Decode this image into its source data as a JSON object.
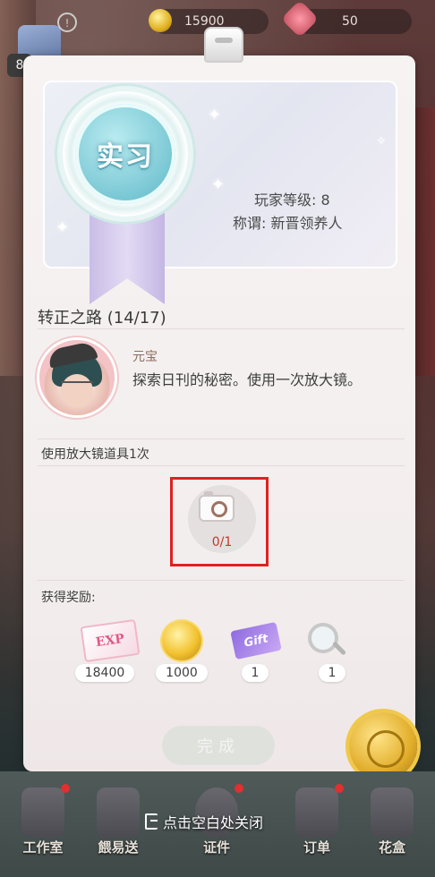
{
  "hud": {
    "gold_amount": "15900",
    "gem_amount": "50",
    "level_badge": "8",
    "hint_symbol": "!"
  },
  "card": {
    "rank_medal_text": "实习",
    "player_level": "玩家等级: 8",
    "player_title": "称谓: 新晋领养人",
    "road_title": "转正之路 (14/17)",
    "npc": {
      "name": "元宝",
      "message": "探索日刊的秘密。使用一次放大镜。"
    },
    "task": {
      "label": "使用放大镜道具1次",
      "progress": "0/1",
      "icon": "camera-icon"
    },
    "rewards_label": "获得奖励:",
    "rewards": [
      {
        "icon": "exp-card-icon",
        "art_text": "EXP",
        "amount": "18400"
      },
      {
        "icon": "gold-coin-icon",
        "amount": "1000"
      },
      {
        "icon": "purple-ticket-icon",
        "art_text": "Gift",
        "amount": "1"
      },
      {
        "icon": "magnifier-icon",
        "amount": "1"
      }
    ],
    "complete_button": "完成"
  },
  "bottom_nav": {
    "close_hint": "点击空白处关闭",
    "items": [
      {
        "label": "工作室",
        "icon": "workshop-icon",
        "badge": true
      },
      {
        "label": "餵易送",
        "icon": "delivery-icon",
        "badge": false
      },
      {
        "label": "证件",
        "icon": "certificate-icon",
        "badge": true
      },
      {
        "label": "订单",
        "icon": "order-icon",
        "badge": true
      },
      {
        "label": "花盒",
        "icon": "flower-box-icon",
        "badge": false
      }
    ]
  },
  "colors": {
    "highlight_box": "#e02020",
    "progress_text": "#c0392b",
    "medal_blue": "#77c6d3",
    "ribbon_purple": "#c9bde6"
  }
}
